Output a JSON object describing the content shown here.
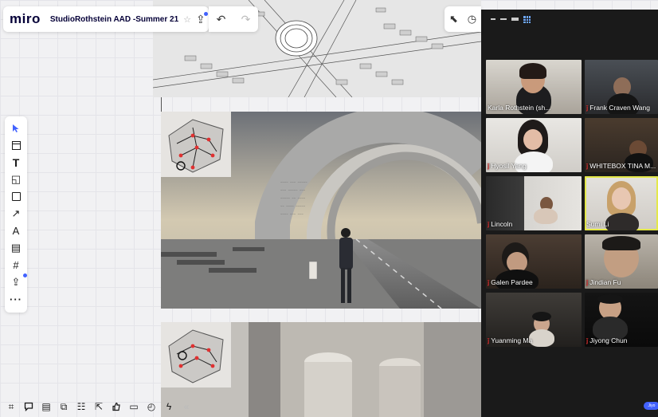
{
  "app": {
    "logo": "miro",
    "board_name": "StudioRothstein AAD -Summer 21",
    "star": "☆"
  },
  "topbar_icons": {
    "upload": "upload-icon",
    "undo": "undo-icon",
    "redo": "redo-icon",
    "undo_glyph": "↶",
    "redo_glyph": "↷",
    "upload_glyph": "⇪"
  },
  "right_controls": {
    "cursor_glyph": "⬉",
    "timer_glyph": "◷"
  },
  "left_toolbar": [
    {
      "name": "select-tool",
      "glyph": "⬆"
    },
    {
      "name": "templates-tool",
      "glyph": ""
    },
    {
      "name": "text-tool",
      "glyph": "T"
    },
    {
      "name": "sticky-note-tool",
      "glyph": "◱"
    },
    {
      "name": "shape-tool",
      "glyph": ""
    },
    {
      "name": "line-tool",
      "glyph": "↗"
    },
    {
      "name": "pen-tool",
      "glyph": "A"
    },
    {
      "name": "comment-tool",
      "glyph": "▤"
    },
    {
      "name": "frame-tool",
      "glyph": "#"
    },
    {
      "name": "upload-tool",
      "glyph": "⇪"
    },
    {
      "name": "more-tools",
      "glyph": "···"
    }
  ],
  "bottom_toolbar": [
    {
      "name": "frames-icon",
      "glyph": "⌗"
    },
    {
      "name": "comments-icon",
      "glyph": "💬"
    },
    {
      "name": "chat-icon",
      "glyph": "▤"
    },
    {
      "name": "screen-share-icon",
      "glyph": "⧉"
    },
    {
      "name": "cards-icon",
      "glyph": "☷"
    },
    {
      "name": "share-icon",
      "glyph": "⇱"
    },
    {
      "name": "reactions-icon",
      "glyph": "👍"
    },
    {
      "name": "video-icon",
      "glyph": "▭"
    },
    {
      "name": "timer-icon",
      "glyph": "◴"
    },
    {
      "name": "voting-icon",
      "glyph": "ϟ"
    },
    {
      "name": "collapse-icon",
      "glyph": "«"
    }
  ],
  "zoom": {
    "participants": [
      {
        "name": "Karla Rothstein (sh...",
        "muted": false,
        "active": false
      },
      {
        "name": "Frank Craven Wang",
        "muted": true,
        "active": false
      },
      {
        "name": "Hyosil Yang",
        "muted": true,
        "active": false
      },
      {
        "name": "WHITEBOX TINA M...",
        "muted": true,
        "active": false
      },
      {
        "name": "Lincoln",
        "muted": true,
        "active": false
      },
      {
        "name": "Sumi Li",
        "muted": false,
        "active": true
      },
      {
        "name": "Galen Pardee",
        "muted": true,
        "active": false
      },
      {
        "name": "Jindian Fu",
        "muted": true,
        "active": false
      },
      {
        "name": "Yuanming Ma",
        "muted": true,
        "active": false
      },
      {
        "name": "Jiyong Chun",
        "muted": true,
        "active": false
      }
    ]
  },
  "corner_badge": "Jiyo",
  "colors": {
    "miro_blue": "#4262ff",
    "zoom_bg": "#1a1a1a",
    "active_speaker": "#e4e84a",
    "muted_red": "#e03131"
  }
}
